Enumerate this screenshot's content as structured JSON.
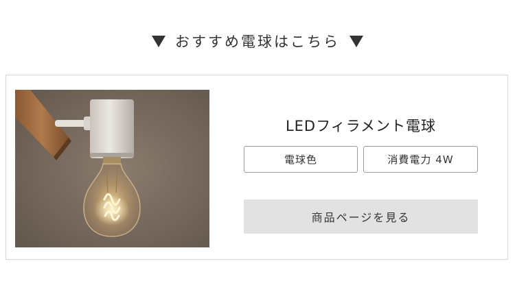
{
  "heading": {
    "text": "おすすめ電球はこちら"
  },
  "product": {
    "name": "LEDフィラメント電球",
    "tags": [
      "電球色",
      "消費電力 4W"
    ],
    "cta_label": "商品ページを見る"
  }
}
